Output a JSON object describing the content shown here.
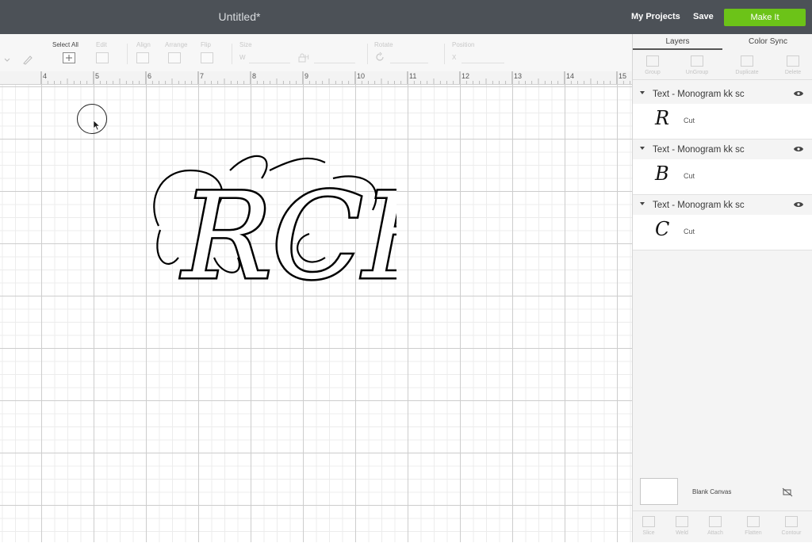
{
  "topbar": {
    "title": "Untitled*",
    "my_projects": "My Projects",
    "save": "Save",
    "make_it": "Make It",
    "accent": "#6cc318"
  },
  "toolbar": {
    "select_all": "Select All",
    "edit": "Edit",
    "align": "Align",
    "arrange": "Arrange",
    "flip": "Flip",
    "size": "Size",
    "size_w": "W",
    "size_h": "H",
    "rotate": "Rotate",
    "position": "Position",
    "pos_x": "X"
  },
  "ruler": {
    "numbers": [
      "4",
      "5",
      "6",
      "7",
      "8",
      "9",
      "10",
      "11",
      "12",
      "13",
      "14",
      "15"
    ]
  },
  "canvas": {
    "monogram_text": "RCB"
  },
  "panel": {
    "tabs": [
      "Layers",
      "Color Sync"
    ],
    "tools": [
      "Group",
      "UnGroup",
      "Duplicate",
      "Delete"
    ],
    "layers": [
      {
        "title": "Text - Monogram kk sc",
        "glyph": "R",
        "op": "Cut"
      },
      {
        "title": "Text - Monogram kk sc",
        "glyph": "B",
        "op": "Cut"
      },
      {
        "title": "Text - Monogram kk sc",
        "glyph": "C",
        "op": "Cut"
      }
    ],
    "blank_canvas": "Blank Canvas",
    "bottom_tools": [
      "Slice",
      "Weld",
      "Attach",
      "Flatten",
      "Contour"
    ]
  }
}
